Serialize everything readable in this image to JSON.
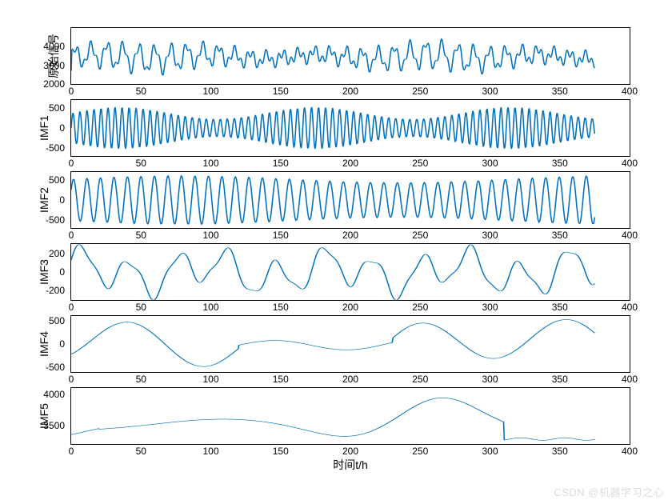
{
  "chart_data": [
    {
      "type": "line",
      "ylabel": "原始信号",
      "xlim": [
        0,
        400
      ],
      "ylim": [
        2000,
        5000
      ],
      "yticks": [
        2000,
        3000,
        4000
      ],
      "series": [
        {
          "name": "原始信号",
          "desc": "noisy oscillation ~3000–4500 range"
        }
      ]
    },
    {
      "type": "line",
      "ylabel": "IMF1",
      "xlim": [
        0,
        400
      ],
      "ylim": [
        -700,
        700
      ],
      "yticks": [
        -500,
        0,
        500
      ],
      "series": [
        {
          "name": "IMF1",
          "desc": "high-freq oscillation ±500"
        }
      ]
    },
    {
      "type": "line",
      "ylabel": "IMF2",
      "xlim": [
        0,
        400
      ],
      "ylim": [
        -700,
        700
      ],
      "yticks": [
        -500,
        0,
        500
      ],
      "series": [
        {
          "name": "IMF2",
          "desc": "mid-freq oscillation ±600"
        }
      ]
    },
    {
      "type": "line",
      "ylabel": "IMF3",
      "xlim": [
        0,
        400
      ],
      "ylim": [
        -300,
        300
      ],
      "yticks": [
        -200,
        0,
        200
      ],
      "series": [
        {
          "name": "IMF3",
          "desc": "slower oscillation ±250"
        }
      ]
    },
    {
      "type": "line",
      "ylabel": "IMF4",
      "xlim": [
        0,
        400
      ],
      "ylim": [
        -600,
        600
      ],
      "yticks": [
        -500,
        0,
        500
      ],
      "series": [
        {
          "name": "IMF4",
          "desc": "very slow oscillation ±500"
        }
      ]
    },
    {
      "type": "line",
      "ylabel": "IMF5",
      "xlim": [
        0,
        400
      ],
      "ylim": [
        3200,
        4100
      ],
      "yticks": [
        3500,
        4000
      ],
      "series": [
        {
          "name": "IMF5",
          "desc": "trend 3300–3950"
        }
      ]
    }
  ],
  "xlabel": "时间t/h",
  "xticks": [
    0,
    50,
    100,
    150,
    200,
    250,
    300,
    350,
    400
  ],
  "watermark": "CSDN @机器学习之心",
  "line_color": "#0072bd"
}
